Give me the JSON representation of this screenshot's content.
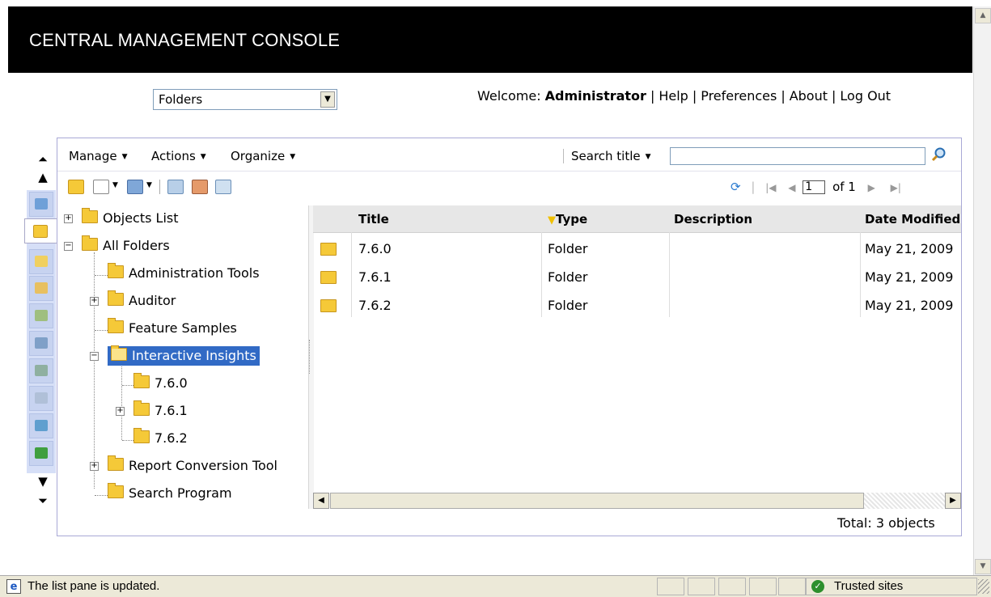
{
  "app": {
    "title": "CENTRAL MANAGEMENT CONSOLE"
  },
  "view_select": {
    "value": "Folders"
  },
  "topnav": {
    "welcome_prefix": "Welcome:",
    "user": "Administrator",
    "separator": "|",
    "links": [
      "Help",
      "Preferences",
      "About",
      "Log Out"
    ]
  },
  "menubar": {
    "manage": "Manage",
    "actions": "Actions",
    "organize": "Organize",
    "search_label": "Search title",
    "search_value": ""
  },
  "pager": {
    "current_page": "1",
    "of_label": "of 1"
  },
  "tree": {
    "items": [
      {
        "label": "Objects List"
      },
      {
        "label": "All Folders"
      },
      {
        "label": "Administration Tools"
      },
      {
        "label": "Auditor"
      },
      {
        "label": "Feature Samples"
      },
      {
        "label": "Interactive Insights"
      },
      {
        "label": "7.6.0"
      },
      {
        "label": "7.6.1"
      },
      {
        "label": "7.6.2"
      },
      {
        "label": "Report Conversion Tool"
      },
      {
        "label": "Search Program"
      }
    ],
    "selected": "Interactive Insights"
  },
  "list": {
    "columns": [
      "Title",
      "Type",
      "Description",
      "Date Modified"
    ],
    "rows": [
      {
        "title": "7.6.0",
        "type": "Folder",
        "description": "",
        "date": "May 21, 2009"
      },
      {
        "title": "7.6.1",
        "type": "Folder",
        "description": "",
        "date": "May 21, 2009"
      },
      {
        "title": "7.6.2",
        "type": "Folder",
        "description": "",
        "date": "May 21, 2009"
      }
    ],
    "total": "Total: 3 objects"
  },
  "statusbar": {
    "message": "The list pane is updated.",
    "zone": "Trusted sites"
  },
  "colors": {
    "header_bg": "#000000",
    "selection": "#316ac5",
    "folder": "#f5c938",
    "panel_border": "#a9a9d6"
  }
}
